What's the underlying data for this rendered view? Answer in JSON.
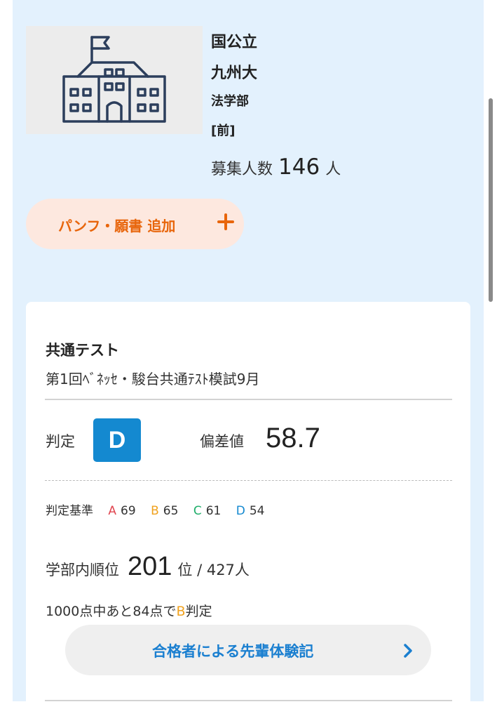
{
  "school": {
    "type": "国公立",
    "university": "九州大",
    "faculty": "法学部",
    "schedule": "[前]",
    "capacity_label": "募集人数",
    "capacity_value": "146",
    "capacity_unit": "人",
    "image_icon": "school-building-icon"
  },
  "actions": {
    "pamphlet_label": "パンフ・願書 追加",
    "pamphlet_icon": "plus-icon"
  },
  "result": {
    "section_title": "共通テスト",
    "exam_name": "第1回ﾍﾞﾈｯｾ・駿台共通ﾃｽﾄ模試9月",
    "judgment_label": "判定",
    "judgment_grade": "D",
    "deviation_label": "偏差値",
    "deviation_value": "58.7",
    "criteria_label": "判定基準",
    "criteria": [
      {
        "grade": "A",
        "value": "69",
        "color": "#e0454f"
      },
      {
        "grade": "B",
        "value": "65",
        "color": "#f0a21e"
      },
      {
        "grade": "C",
        "value": "61",
        "color": "#1fae6a"
      },
      {
        "grade": "D",
        "value": "54",
        "color": "#1489d0"
      }
    ],
    "rank_label": "学部内順位",
    "rank_value": "201",
    "rank_tail": "位 / 427人",
    "target_prefix": "1000点中あと84点で",
    "target_grade": "B",
    "target_suffix": "判定"
  },
  "story_button": {
    "label": "合格者による先輩体験記",
    "icon": "chevron-right-icon"
  },
  "colors": {
    "panel_bg": "#e3f1fd",
    "accent_orange": "#e8650b",
    "accent_blue": "#1a7fd0",
    "grade_box": "#1489d0"
  }
}
